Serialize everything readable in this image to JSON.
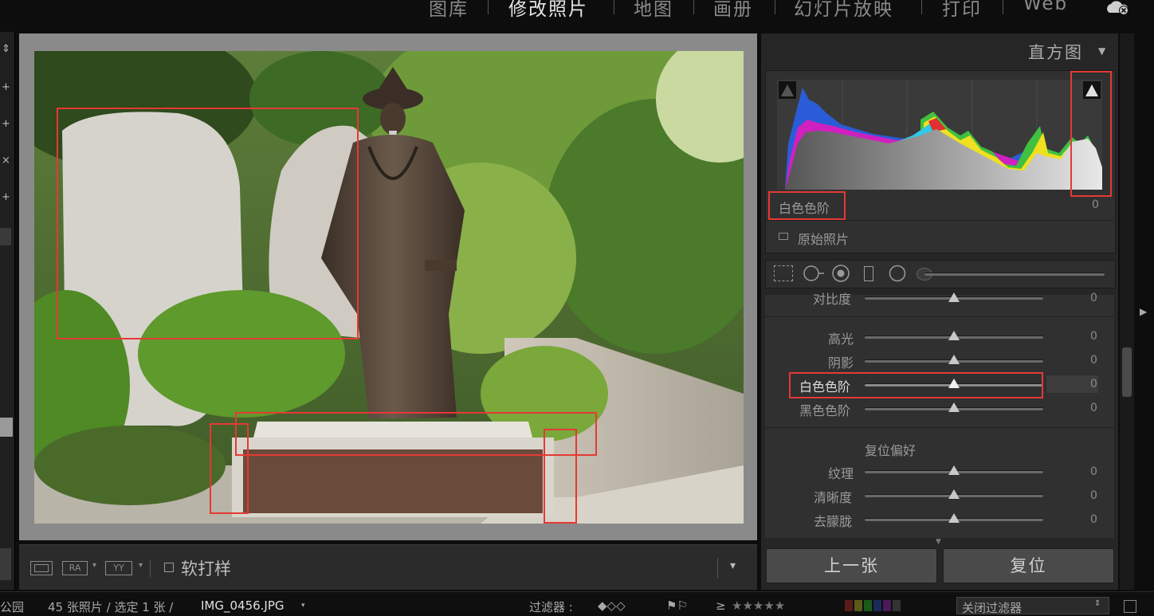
{
  "modules": {
    "library": "图库",
    "develop": "修改照片",
    "map": "地图",
    "book": "画册",
    "slideshow": "幻灯片放映",
    "print": "打印",
    "web": "Web"
  },
  "histogram": {
    "title": "直方图",
    "collapse_glyph": "▼",
    "readout_label": "白色色阶",
    "readout_value": "0",
    "original_photo_label": "原始照片"
  },
  "basic_panel": {
    "contrast": {
      "label": "对比度",
      "value": "0",
      "level": 0.5
    },
    "highlights": {
      "label": "高光",
      "value": "0",
      "level": 0.5
    },
    "shadows": {
      "label": "阴影",
      "value": "0",
      "level": 0.5
    },
    "whites": {
      "label": "白色色阶",
      "value": "0",
      "level": 0.5
    },
    "blacks": {
      "label": "黑色色阶",
      "value": "0",
      "level": 0.5
    },
    "presence_label": "复位偏好",
    "texture": {
      "label": "纹理",
      "value": "0",
      "level": 0.5
    },
    "clarity": {
      "label": "清晰度",
      "value": "0",
      "level": 0.5
    },
    "dehaze": {
      "label": "去朦胧",
      "value": "0",
      "level": 0.5
    }
  },
  "buttons": {
    "previous": "上一张",
    "reset": "复位"
  },
  "toolbar": {
    "soft_proof_label": "软打样",
    "before_after_label": "RA",
    "yy_label": "YY"
  },
  "statusbar": {
    "left_text": "公园",
    "count_text": "45 张照片 / 选定 1 张 /",
    "filename": "IMG_0456.JPG",
    "filter_label": "过滤器 :",
    "filter_off_label": "关闭过滤器",
    "stars": "★★★★★"
  },
  "colors": {
    "accent_red": "#e53935",
    "panel_bg": "#303030",
    "view_bg": "#8a8a8a"
  }
}
